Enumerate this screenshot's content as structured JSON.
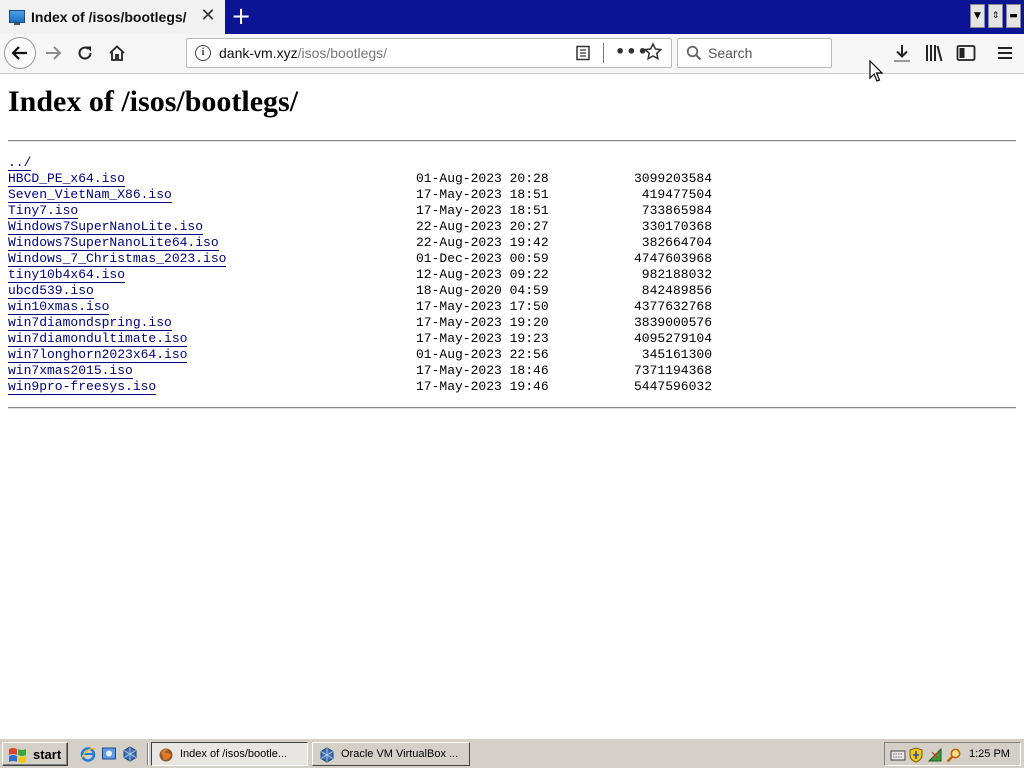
{
  "browser": {
    "tab_title": "Index of /isos/bootlegs/",
    "tab_close_glyph": "✕",
    "new_tab_glyph": "+",
    "url_host": "dank-vm.xyz",
    "url_path": "/isos/bootlegs/",
    "search_placeholder": "Search",
    "icons": [
      "page-favicon-icon",
      "close-icon",
      "plus-icon",
      "back-arrow-icon",
      "forward-arrow-icon",
      "reload-icon",
      "home-icon",
      "info-icon",
      "reader-view-icon",
      "more-dots-icon",
      "bookmark-star-icon",
      "search-icon",
      "download-icon",
      "library-icon",
      "sidebar-icon",
      "hamburger-menu-icon"
    ]
  },
  "page": {
    "heading": "Index of /isos/bootlegs/",
    "parent_link": "../",
    "entries": [
      {
        "name": "HBCD_PE_x64.iso",
        "date": "01-Aug-2023 20:28",
        "size": "3099203584"
      },
      {
        "name": "Seven_VietNam_X86.iso",
        "date": "17-May-2023 18:51",
        "size": "419477504"
      },
      {
        "name": "Tiny7.iso",
        "date": "17-May-2023 18:51",
        "size": "733865984"
      },
      {
        "name": "Windows7SuperNanoLite.iso",
        "date": "22-Aug-2023 20:27",
        "size": "330170368"
      },
      {
        "name": "Windows7SuperNanoLite64.iso",
        "date": "22-Aug-2023 19:42",
        "size": "382664704"
      },
      {
        "name": "Windows_7_Christmas_2023.iso",
        "date": "01-Dec-2023 00:59",
        "size": "4747603968"
      },
      {
        "name": "tiny10b4x64.iso",
        "date": "12-Aug-2023 09:22",
        "size": "982188032"
      },
      {
        "name": "ubcd539.iso",
        "date": "18-Aug-2020 04:59",
        "size": "842489856"
      },
      {
        "name": "win10xmas.iso",
        "date": "17-May-2023 17:50",
        "size": "4377632768"
      },
      {
        "name": "win7diamondspring.iso",
        "date": "17-May-2023 19:20",
        "size": "3839000576"
      },
      {
        "name": "win7diamondultimate.iso",
        "date": "17-May-2023 19:23",
        "size": "4095279104"
      },
      {
        "name": "win7longhorn2023x64.iso",
        "date": "01-Aug-2023 22:56",
        "size": "345161300"
      },
      {
        "name": "win7xmas2015.iso",
        "date": "17-May-2023 18:46",
        "size": "7371194368"
      },
      {
        "name": "win9pro-freesys.iso",
        "date": "17-May-2023 19:46",
        "size": "5447596032"
      }
    ]
  },
  "taskbar": {
    "start_label": "start",
    "tasks": [
      {
        "label": "Index of /isos/bootle...",
        "active": true
      },
      {
        "label": "Oracle VM VirtualBox ...",
        "active": false
      }
    ],
    "clock": "1:25 PM"
  },
  "colors": {
    "tabstrip_bg": "#0b1495",
    "link": "#000080",
    "taskbar_bg": "#d4d0c8"
  }
}
